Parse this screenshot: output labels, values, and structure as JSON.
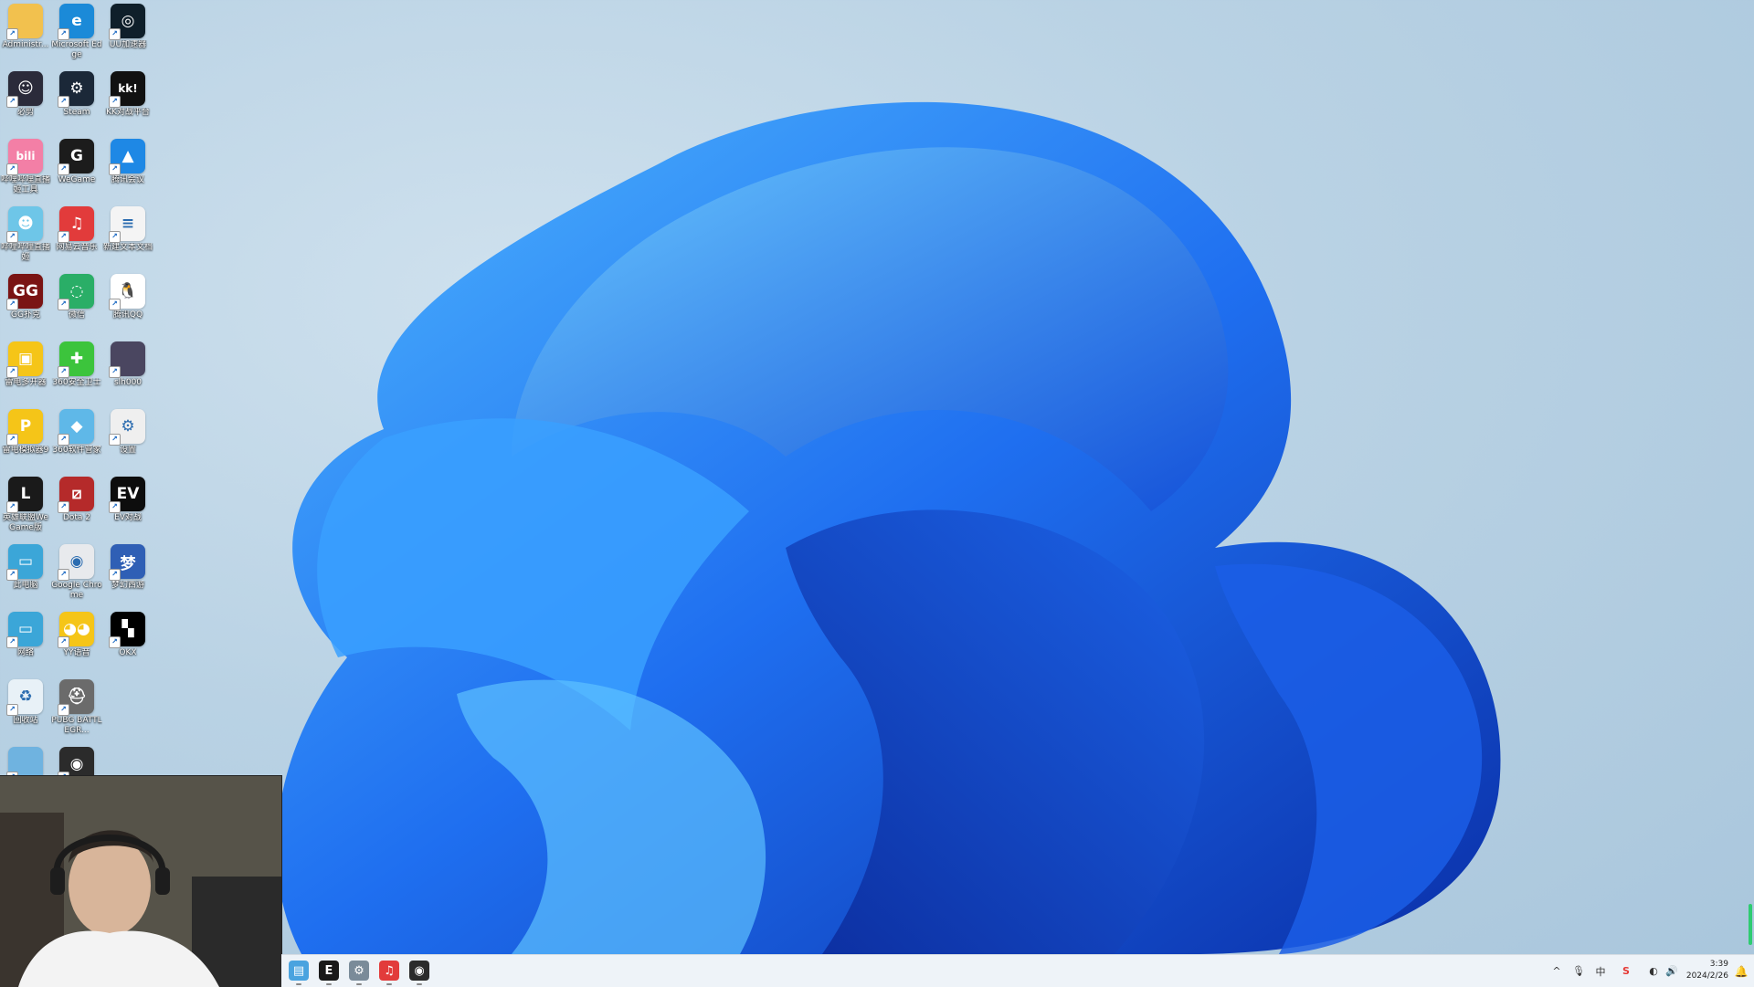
{
  "desktop_icons": [
    {
      "label": "Administr...",
      "icon": "folder-icon",
      "color": "#f2c14e",
      "glyph": "",
      "col": 0,
      "row": 0
    },
    {
      "label": "Microsoft Edge",
      "icon": "edge-icon",
      "color": "#1b8ad8",
      "glyph": "e",
      "col": 1,
      "row": 0
    },
    {
      "label": "UU加速器",
      "icon": "uu-accelerator-icon",
      "color": "#0f1f2a",
      "glyph": "◎",
      "col": 2,
      "row": 0
    },
    {
      "label": "必剪",
      "icon": "bijian-icon",
      "color": "#2b2b3a",
      "glyph": "☺",
      "col": 0,
      "row": 1
    },
    {
      "label": "Steam",
      "icon": "steam-icon",
      "color": "#1b2838",
      "glyph": "⚙",
      "col": 1,
      "row": 1
    },
    {
      "label": "KK对战平台",
      "icon": "kk-platform-icon",
      "color": "#111111",
      "glyph": "kk!",
      "col": 2,
      "row": 1
    },
    {
      "label": "哔哩哔哩直播姬工具",
      "icon": "bilibili-live-icon",
      "color": "#f37fa6",
      "glyph": "bili",
      "col": 0,
      "row": 2
    },
    {
      "label": "WeGame",
      "icon": "wegame-icon",
      "color": "#1c1c1c",
      "glyph": "G",
      "col": 1,
      "row": 2
    },
    {
      "label": "腾讯会议",
      "icon": "tencent-meeting-icon",
      "color": "#1e88e5",
      "glyph": "▲",
      "col": 2,
      "row": 2
    },
    {
      "label": "哔哩哔哩直播姬",
      "icon": "bilibili-live-assistant-icon",
      "color": "#6ec6e8",
      "glyph": "☻",
      "col": 0,
      "row": 3
    },
    {
      "label": "网易云音乐",
      "icon": "netease-music-icon",
      "color": "#e23b3b",
      "glyph": "♫",
      "col": 1,
      "row": 3
    },
    {
      "label": "新建文本文档",
      "icon": "text-document-icon",
      "color": "#f4f4f4",
      "glyph": "≡",
      "col": 2,
      "row": 3
    },
    {
      "label": "GG扑克",
      "icon": "gg-poker-icon",
      "color": "#7a1414",
      "glyph": "GG",
      "col": 0,
      "row": 4
    },
    {
      "label": "微信",
      "icon": "wechat-icon",
      "color": "#2aae67",
      "glyph": "◌",
      "col": 1,
      "row": 4
    },
    {
      "label": "腾讯QQ",
      "icon": "qq-icon",
      "color": "#ffffff",
      "glyph": "🐧",
      "col": 2,
      "row": 4
    },
    {
      "label": "雷电多开器",
      "icon": "leidian-multi-icon",
      "color": "#f5c518",
      "glyph": "▣",
      "col": 0,
      "row": 5
    },
    {
      "label": "360安全卫士",
      "icon": "360-security-icon",
      "color": "#3cc43c",
      "glyph": "✚",
      "col": 1,
      "row": 5
    },
    {
      "label": "slh000",
      "icon": "image-file-icon",
      "color": "#4a4660",
      "glyph": "",
      "col": 2,
      "row": 5
    },
    {
      "label": "雷电模拟器9",
      "icon": "leidian-emulator-icon",
      "color": "#f5c518",
      "glyph": "P",
      "col": 0,
      "row": 6
    },
    {
      "label": "360软件管家",
      "icon": "360-software-manager-icon",
      "color": "#5fb8e8",
      "glyph": "◆",
      "col": 1,
      "row": 6
    },
    {
      "label": "设置",
      "icon": "settings-file-icon",
      "color": "#efefef",
      "glyph": "⚙",
      "col": 2,
      "row": 6
    },
    {
      "label": "英雄联盟WeGame版",
      "icon": "league-of-legends-icon",
      "color": "#1a1a1a",
      "glyph": "L",
      "col": 0,
      "row": 7
    },
    {
      "label": "Dota 2",
      "icon": "dota2-icon",
      "color": "#b52a2a",
      "glyph": "⧄",
      "col": 1,
      "row": 7
    },
    {
      "label": "EV对战",
      "icon": "ev-platform-icon",
      "color": "#0d0d0d",
      "glyph": "EV",
      "col": 2,
      "row": 7
    },
    {
      "label": "此电脑",
      "icon": "this-pc-icon",
      "color": "#3ba6d8",
      "glyph": "▭",
      "col": 0,
      "row": 8
    },
    {
      "label": "Google Chrome",
      "icon": "chrome-icon",
      "color": "#e8eaed",
      "glyph": "◉",
      "col": 1,
      "row": 8
    },
    {
      "label": "梦幻西游",
      "icon": "menghuan-xiyou-icon",
      "color": "#2f5fb5",
      "glyph": "梦",
      "col": 2,
      "row": 8
    },
    {
      "label": "网络",
      "icon": "network-icon",
      "color": "#3ba6d8",
      "glyph": "▭",
      "col": 0,
      "row": 9
    },
    {
      "label": "YY语音",
      "icon": "yy-voice-icon",
      "color": "#f5c518",
      "glyph": "◕◕",
      "col": 1,
      "row": 9
    },
    {
      "label": "OKX",
      "icon": "okx-icon",
      "color": "#000000",
      "glyph": "▚",
      "col": 2,
      "row": 9
    },
    {
      "label": "回收站",
      "icon": "recycle-bin-icon",
      "color": "#e8f1f7",
      "glyph": "♻",
      "col": 0,
      "row": 10
    },
    {
      "label": "PUBG BATTLEGR...",
      "icon": "pubg-icon",
      "color": "#6b6b6b",
      "glyph": "⛑",
      "col": 1,
      "row": 10
    },
    {
      "label": "",
      "icon": "control-panel-icon",
      "color": "#6fb3e0",
      "glyph": "",
      "col": 0,
      "row": 11
    },
    {
      "label": "",
      "icon": "obs-icon",
      "color": "#2b2b2b",
      "glyph": "◉",
      "col": 1,
      "row": 11
    }
  ],
  "taskbar": {
    "apps": [
      {
        "name": "file-explorer",
        "icon": "folder-icon",
        "color": "#4aa3df",
        "glyph": "▤"
      },
      {
        "name": "epic-games",
        "icon": "epic-games-icon",
        "color": "#1a1a1a",
        "glyph": "E"
      },
      {
        "name": "settings",
        "icon": "gear-icon",
        "color": "#7a8b99",
        "glyph": "⚙"
      },
      {
        "name": "netease-music",
        "icon": "netease-music-icon",
        "color": "#e23b3b",
        "glyph": "♫"
      },
      {
        "name": "obs-studio",
        "icon": "obs-icon",
        "color": "#2b2b2b",
        "glyph": "◉"
      }
    ],
    "tray": {
      "chevron": "^",
      "microphone": "🎙",
      "ime": "中",
      "wps": "S",
      "network": "◐",
      "volume": "🔊"
    },
    "clock": {
      "time": "3:39",
      "date": "2024/2/26"
    }
  }
}
